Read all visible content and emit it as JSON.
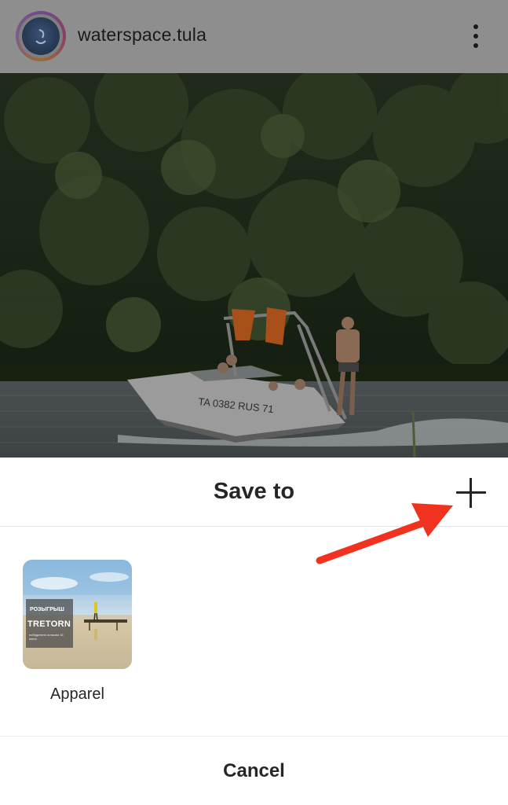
{
  "header": {
    "username": "waterspace.tula",
    "menu_icon": "more-vertical-icon"
  },
  "post": {
    "boat_registration": "TA 0382 RUS 71"
  },
  "sheet": {
    "title": "Save to",
    "add_icon": "plus-icon",
    "collections": [
      {
        "name": "Apparel",
        "thumb_line1": "РОЗЫГРЫШ",
        "thumb_line2": "TRETORN",
        "thumb_line3": "победителя огласим 15 июня"
      }
    ],
    "cancel_label": "Cancel"
  },
  "annotation": {
    "arrow_color": "#f0321e"
  }
}
